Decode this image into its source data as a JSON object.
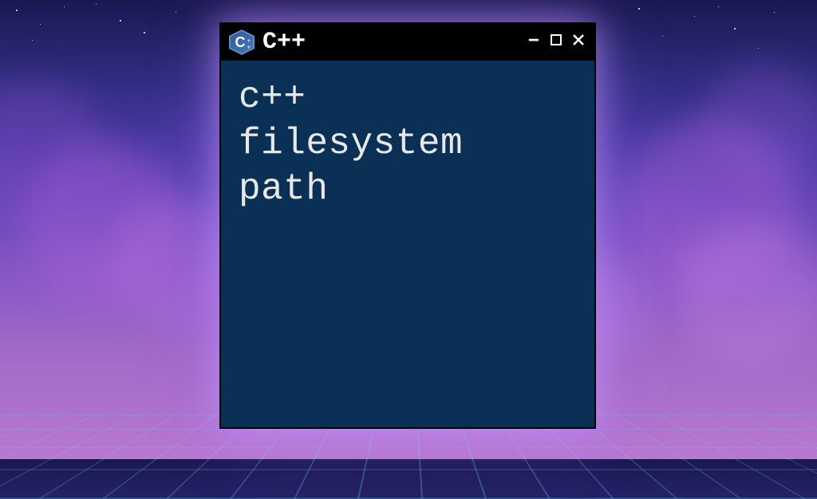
{
  "window": {
    "title": "C++",
    "logo_letter": "C",
    "body_line1": "c++",
    "body_line2": "filesystem",
    "body_line3": "path"
  },
  "controls": {
    "minimize": "−",
    "maximize": "□",
    "close": "✕"
  }
}
